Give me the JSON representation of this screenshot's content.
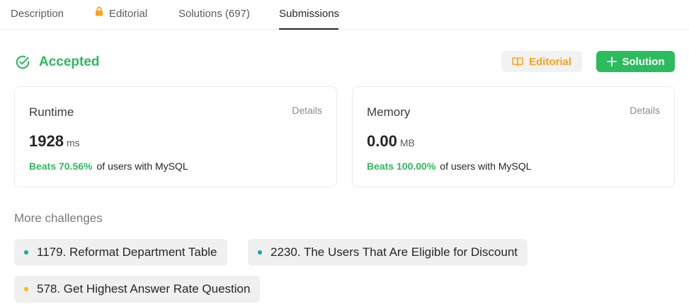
{
  "tabs": [
    {
      "label": "Description",
      "active": false
    },
    {
      "label": "Editorial",
      "active": false,
      "locked": true
    },
    {
      "label": "Solutions (697)",
      "active": false
    },
    {
      "label": "Submissions",
      "active": true
    }
  ],
  "status": {
    "label": "Accepted",
    "color": "#2cbb5d"
  },
  "actions": {
    "editorial_label": "Editorial",
    "solution_label": "Solution"
  },
  "runtime": {
    "title": "Runtime",
    "details_label": "Details",
    "value": "1928",
    "unit": "ms",
    "beats": "Beats 70.56%",
    "beats_suffix": "of users with MySQL"
  },
  "memory": {
    "title": "Memory",
    "details_label": "Details",
    "value": "0.00",
    "unit": "MB",
    "beats": "Beats 100.00%",
    "beats_suffix": "of users with MySQL"
  },
  "more_challenges": {
    "title": "More challenges",
    "items": [
      {
        "label": "1179. Reformat Department Table",
        "difficulty_color": "#00af9b"
      },
      {
        "label": "2230. The Users That Are Eligible for Discount",
        "difficulty_color": "#00af9b"
      },
      {
        "label": "578. Get Highest Answer Rate Question",
        "difficulty_color": "#ffb800"
      }
    ]
  },
  "colors": {
    "accent_green": "#2cbb5d",
    "accent_orange": "#ffa116",
    "easy": "#00af9b",
    "medium": "#ffb800"
  }
}
